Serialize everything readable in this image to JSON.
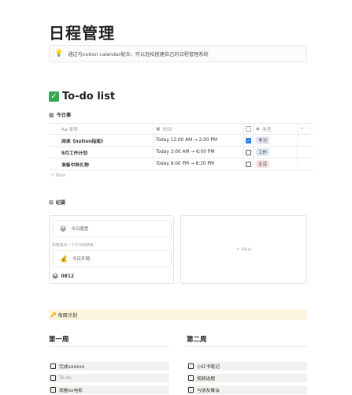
{
  "page": {
    "title": "日程管理",
    "callout": {
      "icon": "lightbulb-icon",
      "text": "通过与notion calendar配合，可以轻松搭建自己的日程管理系统"
    }
  },
  "todo": {
    "heading": "To-do list",
    "icon": "check-mark-icon",
    "view_tab": "今日事",
    "columns": {
      "name": "Aa 事项",
      "time": "时间",
      "check": "",
      "type": "类型",
      "add": "+",
      "more": "···"
    },
    "rows": [
      {
        "name": "阅读《notion指南》",
        "time": "Today 12:00 AM → 2:00 PM",
        "checked": true,
        "type": "学习",
        "type_color": "#e9e5f8"
      },
      {
        "name": "9月工作计划",
        "time": "Today 3:00 AM → 6:00 PM",
        "checked": false,
        "type": "工作",
        "type_color": "#dbeaf7"
      },
      {
        "name": "准备中秋礼物",
        "time": "Today 8:00 PM → 8:30 PM",
        "checked": false,
        "type": "生活",
        "type_color": "#fbe4e4"
      }
    ],
    "new_label": "+ New"
  },
  "gallery": {
    "view_tab": "纪要",
    "card": {
      "inner1": {
        "emoji": "😀",
        "label": "今日感受"
      },
      "note": "简要描述一下今天的感受",
      "inner2": {
        "emoji": "💰",
        "label": "今日开销"
      },
      "footer": {
        "emoji": "😀",
        "label": "0812"
      }
    },
    "new_card": "+ New"
  },
  "weekly": {
    "emoji": "🔑",
    "label": "每周计划",
    "week1": {
      "title": "第一周",
      "tasks": [
        {
          "label": "完成xxxxxx",
          "muted": false
        },
        {
          "label": "To-do",
          "muted": true
        },
        {
          "label": "观看xx电影",
          "muted": false
        }
      ]
    },
    "week2": {
      "title": "第二周",
      "tasks": [
        {
          "label": "小红书笔记",
          "muted": false
        },
        {
          "label": "视频选题",
          "muted": false
        },
        {
          "label": "与朋友聚会",
          "muted": false
        }
      ]
    }
  }
}
